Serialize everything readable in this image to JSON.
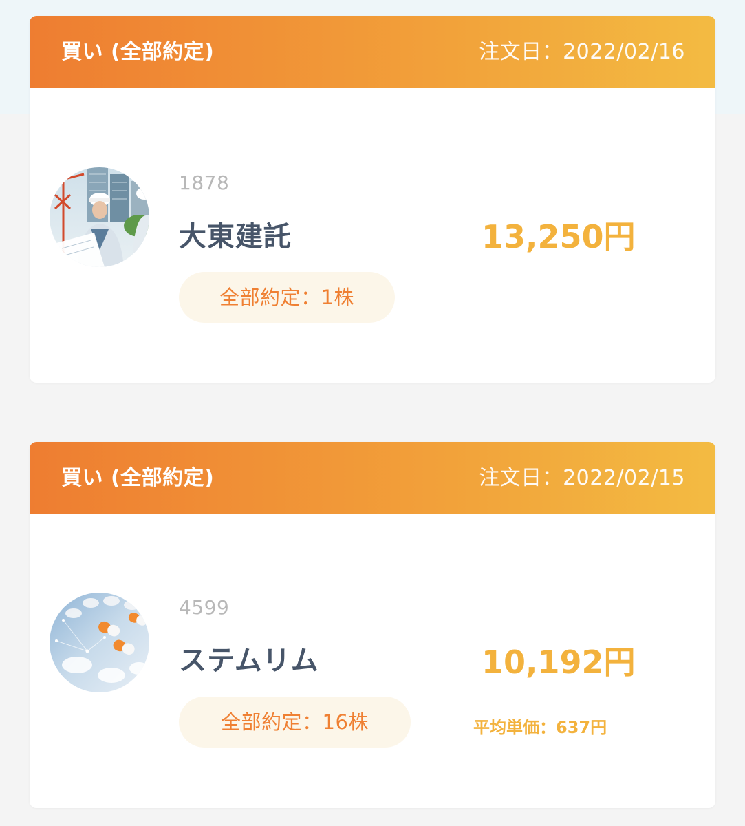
{
  "orders": [
    {
      "order_type": "買い (全部約定)",
      "order_date": "注文日：2022/02/16",
      "code": "1878",
      "name": "大東建託",
      "fill_label": "全部約定：1株",
      "amount": "13,250円",
      "avg_price": "",
      "image": "construction-workers-photo"
    },
    {
      "order_type": "買い (全部約定)",
      "order_date": "注文日：2022/02/15",
      "code": "4599",
      "name": "ステムリム",
      "fill_label": "全部約定：16株",
      "amount": "10,192円",
      "avg_price": "平均単価：637円",
      "image": "medicine-capsules-photo"
    }
  ],
  "colors": {
    "header_gradient_start": "#ee7d31",
    "header_gradient_end": "#f3bb42",
    "amount": "#f3b23d",
    "pill_bg": "#fcf6e9",
    "pill_text": "#ef8033",
    "name_text": "#475569",
    "code_text": "#b8b8b8"
  }
}
